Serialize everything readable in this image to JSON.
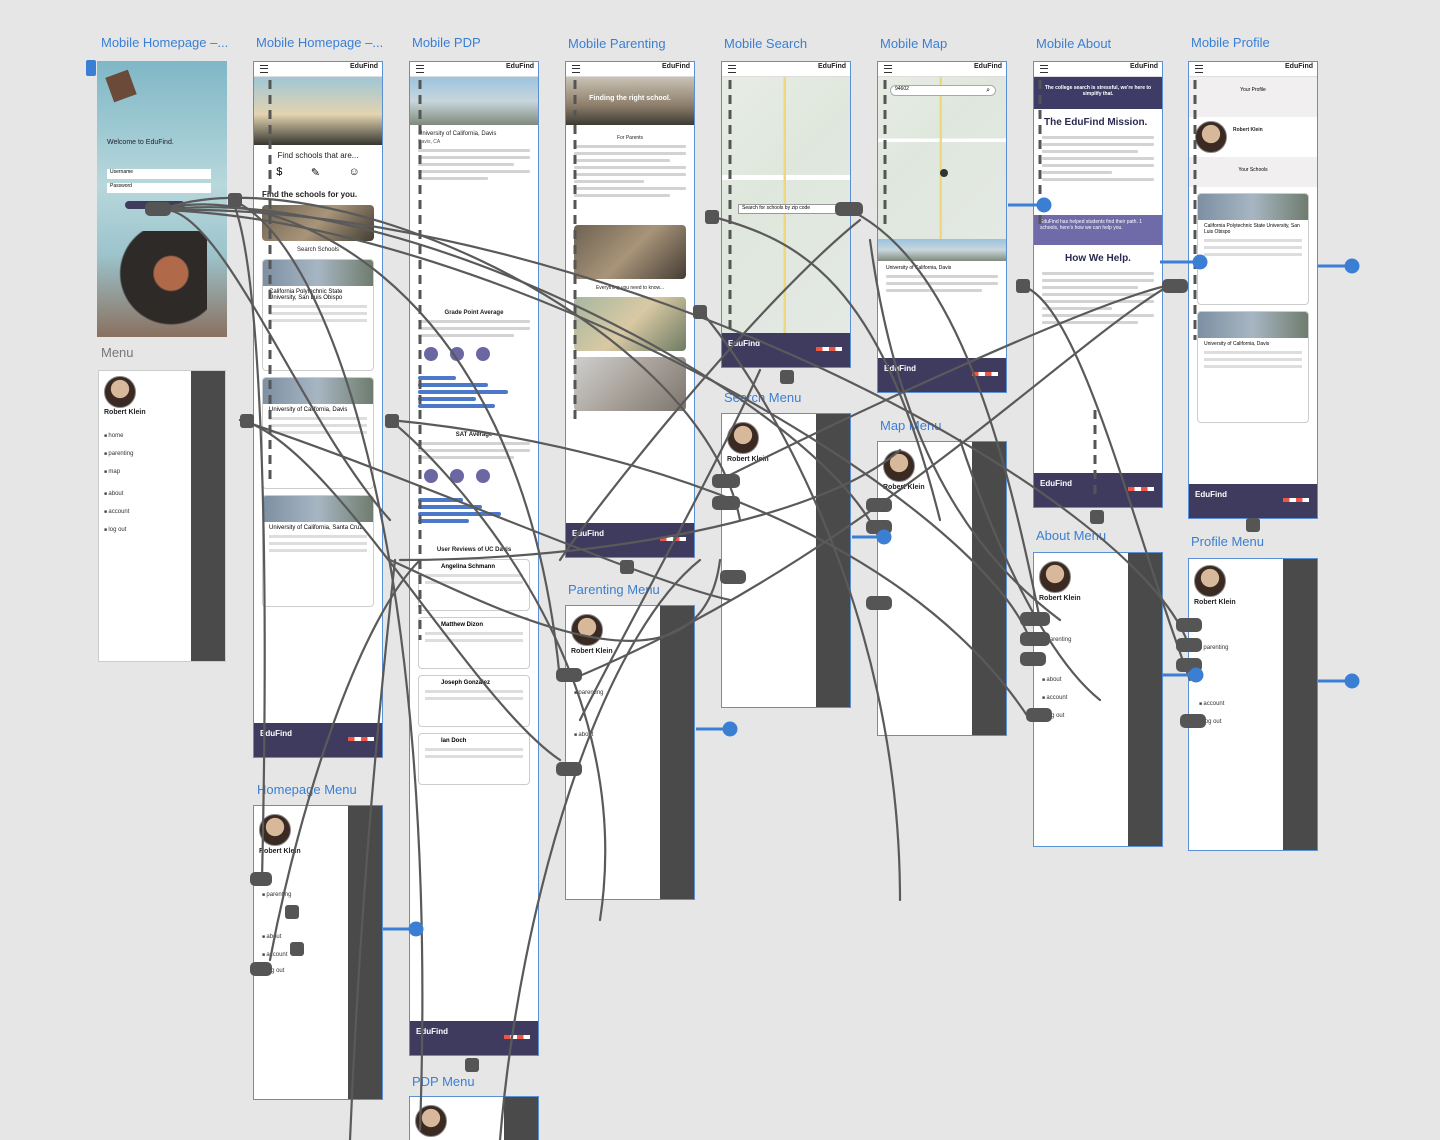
{
  "artboard_titles": [
    "Mobile Homepage –...",
    "Mobile Homepage –...",
    "Mobile PDP",
    "Mobile Parenting",
    "Mobile Search",
    "Mobile Map",
    "Mobile About",
    "Mobile Profile"
  ],
  "menu_titles": {
    "menu": "Menu",
    "homepage_menu": "Homepage Menu",
    "pdp_menu": "PDP Menu",
    "parenting_menu": "Parenting Menu",
    "search_menu": "Search Menu",
    "map_menu": "Map Menu",
    "about_menu": "About Menu",
    "profile_menu": "Profile Menu"
  },
  "brand": "EduFind",
  "welcome": {
    "title": "Welcome to EduFind.",
    "username_label": "Username",
    "password_label": "Password"
  },
  "homepage": {
    "find_that_are": "Find schools that are...",
    "find_for_you": "Find the schools for you.",
    "search_schools": "Search Schools",
    "cards": [
      "California Polytechnic State University, San Luis Obispo",
      "University of California, Davis",
      "University of California, Santa Cruz"
    ]
  },
  "pdp": {
    "school": "University of California, Davis",
    "location": "Davis, CA",
    "gpa": "Grade Point Average",
    "sat": "SAT Average",
    "reviews": "User Reviews of UC Davis",
    "reviewers": [
      "Angelina Schmann",
      "Matthew Dizon",
      "Joseph Gonzalez",
      "Ian Doch"
    ]
  },
  "parenting": {
    "hero": "Finding the right school.",
    "for_parents": "For Parents",
    "everything": "Everything you need to know..."
  },
  "search": {
    "placeholder": "Search for schools by zip code",
    "result": "University of California, Davis"
  },
  "map": {
    "query": "94602",
    "result": "University of California, Davis"
  },
  "about": {
    "hero": "The college search is stressful, we're here to simplify that.",
    "mission": "The EduFind Mission.",
    "banner": "EduFind has helped students find their path. 1 schools, here's how we can help you.",
    "how": "How We Help."
  },
  "profile": {
    "your_profile": "Your Profile",
    "name": "Robert Klein",
    "your_schools": "Your Schools",
    "school1": "California Polytechnic State University, San Luis Obispo",
    "school2": "University of California, Davis"
  },
  "menu_user": "Robert Klein",
  "menu_items": [
    "home",
    "parenting",
    "map",
    "about",
    "account",
    "log out"
  ],
  "colors": {
    "canvas": "#e6e6e6",
    "artboard_border": "#5b8fd6",
    "label_blue": "#3b7fd4",
    "wire": "#5a5a5a",
    "footer": "#3f3b5f",
    "accent_purple": "#6f6aa8"
  }
}
